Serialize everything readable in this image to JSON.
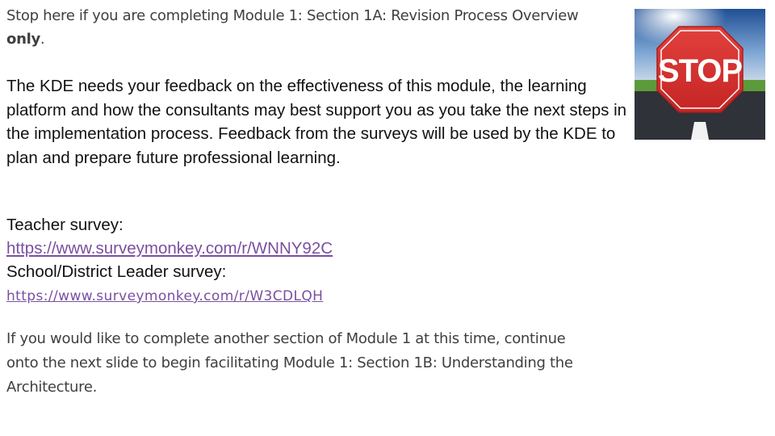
{
  "intro": {
    "text": "Stop here if you are completing Module 1: Section 1A:  Revision Process Overview ",
    "emphasis": "only",
    "end": "."
  },
  "feedback": {
    "text": "The KDE needs your feedback on the effectiveness of this module, the learning platform and how the consultants may best support you as you take the next steps in the implementation process. Feedback from the surveys will be used by the KDE to plan and prepare future professional learning."
  },
  "surveys": {
    "teacher_label": "Teacher survey:",
    "teacher_link": "https://www.surveymonkey.com/r/WNNY92C",
    "leader_label": "School/District Leader survey:",
    "leader_link": "https://www.surveymonkey.com/r/W3CDLQH"
  },
  "continue": {
    "text": "If you would like to complete another section of Module 1 at this time, continue onto the next slide to begin facilitating Module 1: Section 1B: Understanding the Architecture."
  },
  "image": {
    "sign_text": "STOP",
    "icon": "stop-sign-icon",
    "colors": {
      "sign_red": "#d8312f",
      "sky": "#3a6fb0",
      "road": "#2f3238",
      "grass": "#5d9a3a"
    }
  }
}
